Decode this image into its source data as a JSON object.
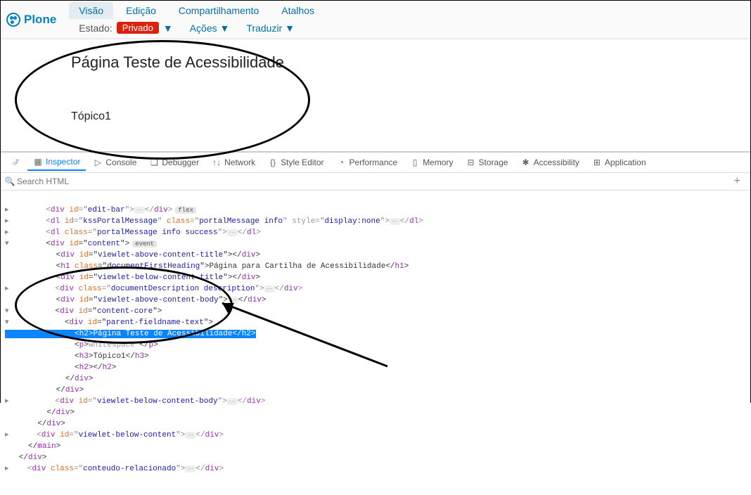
{
  "logo": {
    "text": "Plone"
  },
  "tabs": {
    "view": "Visão",
    "edit": "Edição",
    "share": "Compartilhamento",
    "shortcuts": "Atalhos"
  },
  "state": {
    "label": "Estado:",
    "value": "Privado",
    "actions": "Ações",
    "translate": "Traduzir"
  },
  "content": {
    "title": "Página Teste de Acessibilidade",
    "topic": "Tópico1"
  },
  "devtools": {
    "tabs": {
      "inspector": "Inspector",
      "console": "Console",
      "debugger": "Debugger",
      "network": "Network",
      "styleEditor": "Style Editor",
      "performance": "Performance",
      "memory": "Memory",
      "storage": "Storage",
      "accessibility": "Accessibility",
      "application": "Application"
    },
    "searchPlaceholder": "Search HTML",
    "dom": {
      "editBarId": "edit-bar",
      "flex": "flex",
      "kssId": "kssPortalMessage",
      "kssClass": "portalMessage info",
      "kssStyle": "display:none",
      "dlClass": "portalMessage info success",
      "contentId": "content",
      "event": "event",
      "aboveTitleId": "viewlet-above-content-title",
      "h1Class": "documentFirstHeading",
      "h1Text": "Página para Cartilha de Acessibilidade",
      "belowTitleId": "viewlet-below-content-title",
      "descClass": "documentDescription description",
      "aboveBodyId": "viewlet-above-content-body",
      "coreId": "content-core",
      "parentFieldId": "parent-fieldname-text",
      "h2Text": "Página Teste de Acessibilidade",
      "pWhitespace": "whitespace",
      "h3Text": "Tópico1",
      "belowBodyId": "viewlet-below-content-body",
      "belowContentId": "viewlet-below-content",
      "relacionadoClass": "conteudo-relacionado"
    }
  }
}
